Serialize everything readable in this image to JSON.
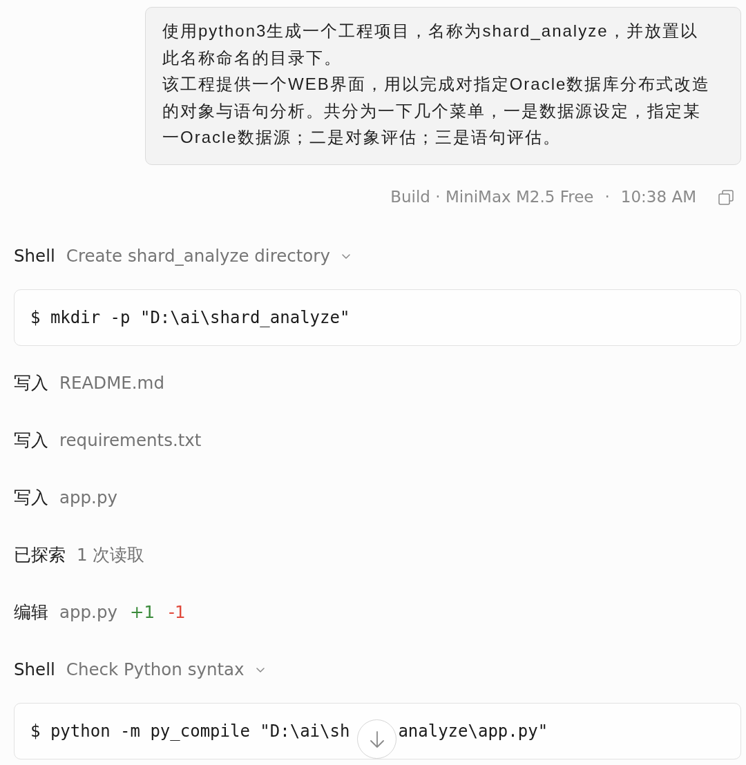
{
  "message": {
    "paragraphs": [
      "使用python3生成一个工程项目，名称为shard_analyze，并放置以此名称命名的目录下。",
      "该工程提供一个WEB界面，用以完成对指定Oracle数据库分布式改造的对象与语句分析。共分为一下几个菜单，一是数据源设定，指定某一Oracle数据源；二是对象评估；三是语句评估。"
    ]
  },
  "meta": {
    "agent": "Build · MiniMax M2.5 Free",
    "separator": "·",
    "time": "10:38 AM"
  },
  "steps": [
    {
      "kind": "shell",
      "label": "Shell",
      "title": "Create shard_analyze directory",
      "command_parts": [
        "$ mkdir -p \"D:\\ai\\shard_analyze\""
      ]
    },
    {
      "kind": "action",
      "label": "写入",
      "target": "README.md"
    },
    {
      "kind": "action",
      "label": "写入",
      "target": "requirements.txt"
    },
    {
      "kind": "action",
      "label": "写入",
      "target": "app.py"
    },
    {
      "kind": "action",
      "label": "已探索",
      "target": "1 次读取"
    },
    {
      "kind": "edit",
      "label": "编辑",
      "target": "app.py",
      "added": "+1",
      "removed": "-1"
    },
    {
      "kind": "shell",
      "label": "Shell",
      "title": "Check Python syntax",
      "command_parts": [
        "$ python -m py_compile \"D:\\ai\\sh",
        "analyze\\app.py\""
      ]
    }
  ]
}
